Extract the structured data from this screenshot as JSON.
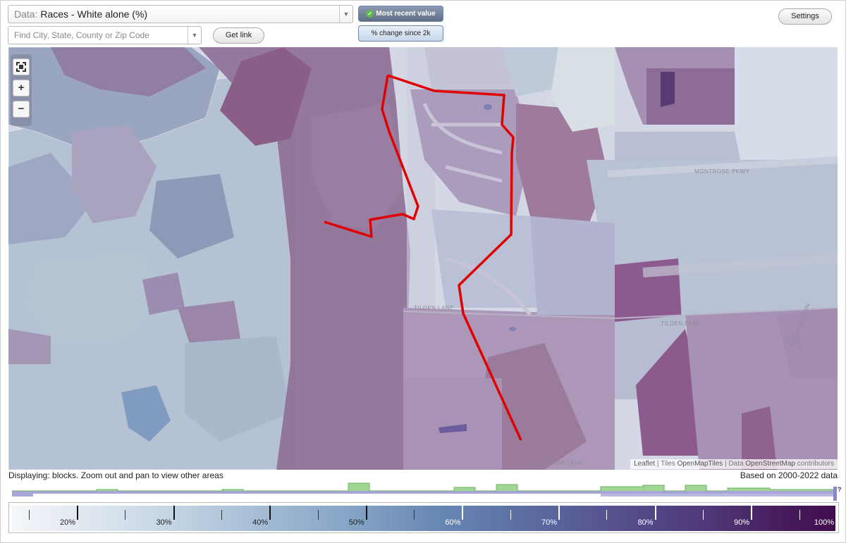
{
  "header": {
    "data_prefix": "Data:",
    "data_value": "Races - White alone (%)",
    "search_placeholder": "Find City, State, County or Zip Code",
    "get_link_label": "Get link",
    "mode_active_label": "Most recent value",
    "mode_inactive_label": "% change since 2k",
    "settings_label": "Settings",
    "dropdown_arrow": "▼"
  },
  "map": {
    "zoom_in": "+",
    "zoom_out": "−",
    "fullscreen_icon": "fullscreen-icon",
    "streets": {
      "montrose": "MONTROSE PKWY",
      "tilden_west": "TILDEN LANE",
      "tilden_east": "TILDEN LANE",
      "tuckerman": "TUCKERMAN LANE",
      "old_georgetown": "OLD GEORGETOWN RD"
    },
    "attribution": {
      "leaflet": "Leaflet",
      "sep1": " | Tiles ",
      "tiles": "OpenMapTiles",
      "sep2": " | Data ",
      "data": "OpenStreetMap",
      "suffix": " contributors"
    }
  },
  "footer": {
    "displaying": "Displaying: blocks. Zoom out and pan to view other areas",
    "based_on": "Based on 2000-2022 data",
    "histogram_help": "?"
  },
  "legend": {
    "labels": [
      "20%",
      "30%",
      "40%",
      "50%",
      "60%",
      "70%",
      "80%",
      "90%",
      "100%"
    ],
    "colors": {
      "low": "#f4f6fa",
      "mid": "#6787b4",
      "high": "#420d4f"
    }
  },
  "colors": {
    "accent_line": "#e00000",
    "histogram_fill": "#9fd693",
    "histogram_base": "#a8a6d8"
  }
}
